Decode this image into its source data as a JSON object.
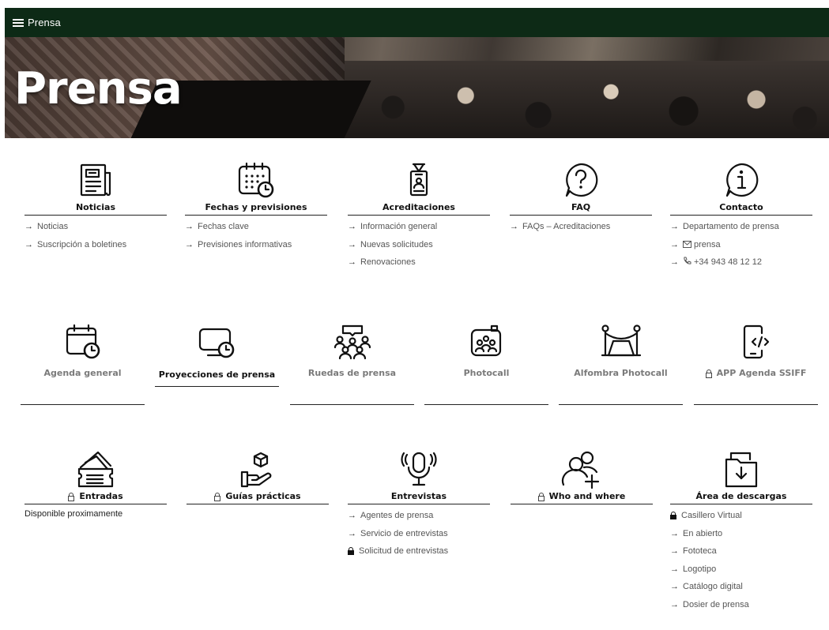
{
  "header": {
    "menu_label": "Prensa"
  },
  "hero": {
    "title": "Prensa"
  },
  "row1": [
    {
      "title": "Noticias",
      "icon": "newspaper-icon",
      "links": [
        "Noticias",
        "Suscripción a boletines"
      ]
    },
    {
      "title": "Fechas y previsiones",
      "icon": "calendar-clock-icon",
      "links": [
        "Fechas clave",
        "Previsiones informativas"
      ]
    },
    {
      "title": "Acreditaciones",
      "icon": "badge-lanyard-icon",
      "links": [
        "Información general",
        "Nuevas solicitudes",
        "Renovaciones"
      ]
    },
    {
      "title": "FAQ",
      "icon": "question-circle-icon",
      "links": [
        "FAQs – Acreditaciones"
      ]
    },
    {
      "title": "Contacto",
      "icon": "info-circle-icon",
      "links": [
        "Departamento de prensa",
        "prensa",
        "+34 943 48 12 12"
      ]
    }
  ],
  "row2": [
    {
      "title": "Agenda general",
      "icon": "calendar-clock-icon"
    },
    {
      "title": "Proyecciones de prensa",
      "icon": "screen-clock-icon"
    },
    {
      "title": "Ruedas de prensa",
      "icon": "press-conference-icon"
    },
    {
      "title": "Photocall",
      "icon": "camera-people-icon"
    },
    {
      "title": "Alfombra Photocall",
      "icon": "red-carpet-icon"
    },
    {
      "title": "APP Agenda SSIFF",
      "icon": "mobile-code-icon"
    }
  ],
  "row3": [
    {
      "title": "Entradas",
      "icon": "tickets-icon",
      "note": "Disponible proximamente"
    },
    {
      "title": "Guías prácticas",
      "icon": "hand-box-icon"
    },
    {
      "title": "Entrevistas",
      "icon": "microphone-icon",
      "links": [
        "Agentes de prensa",
        "Servicio de entrevistas",
        "Solicitud de entrevistas"
      ]
    },
    {
      "title": "Who and where",
      "icon": "add-user-icon"
    },
    {
      "title": "Área de descargas",
      "icon": "download-folder-icon",
      "links": [
        "Casillero Virtual",
        "En abierto",
        "Fototeca",
        "Logotipo",
        "Catálogo digital",
        "Dosier de prensa"
      ]
    }
  ],
  "glyphs": {
    "arrow": "→"
  }
}
